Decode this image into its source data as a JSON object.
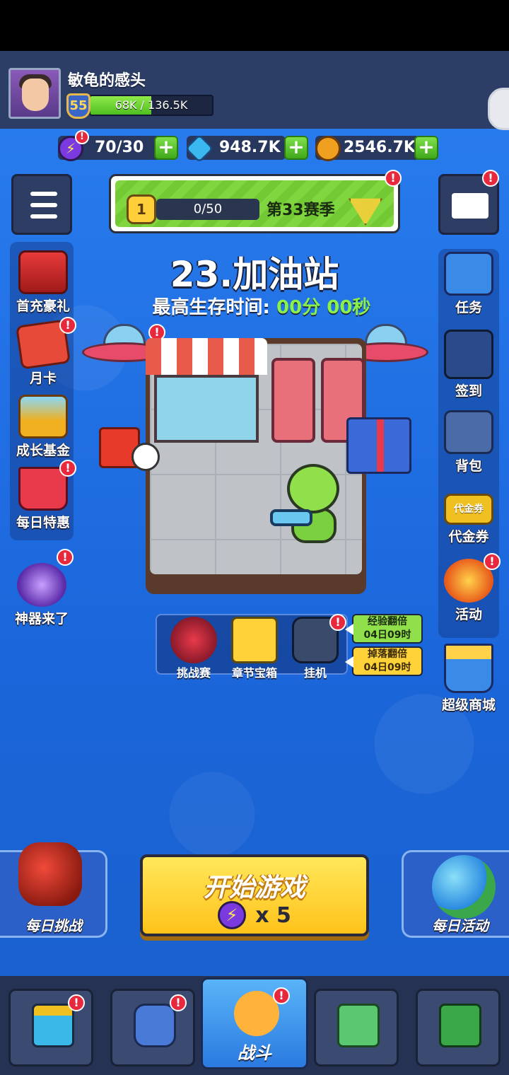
{
  "player": {
    "name": "敏龟的感头",
    "level": "55",
    "xp_text": "68K / 136.5K",
    "xp_fraction": 0.5
  },
  "resources": [
    {
      "icon": "energy-icon",
      "value": "70/30",
      "color": "#7a3ae0"
    },
    {
      "icon": "diamond-icon",
      "value": "948.7K",
      "color": "#3ab8f0"
    },
    {
      "icon": "coin-icon",
      "value": "2546.7K",
      "color": "#f0a020"
    }
  ],
  "season": {
    "level": "1",
    "progress": "0/50",
    "title": "第33赛季"
  },
  "stage": {
    "title": "23.加油站",
    "survive_label": "最高生存时间:",
    "survive_value": "00分 00秒"
  },
  "left_menu": [
    {
      "label": "首充豪礼",
      "icon": "treasure-chest-icon",
      "badge": false
    },
    {
      "label": "月卡",
      "icon": "month-card-icon",
      "badge": true
    },
    {
      "label": "成长基金",
      "icon": "growth-fund-icon",
      "badge": false
    },
    {
      "label": "每日特惠",
      "icon": "basket-icon",
      "badge": true
    },
    {
      "label": "神器来了",
      "icon": "artifact-icon",
      "badge": true
    }
  ],
  "right_menu": [
    {
      "label": "任务",
      "icon": "task-icon",
      "badge": false
    },
    {
      "label": "签到",
      "icon": "signin-icon",
      "badge": false
    },
    {
      "label": "背包",
      "icon": "backpack-icon",
      "badge": false
    },
    {
      "label": "代金券",
      "icon": "voucher-icon",
      "art_text": "代金券",
      "badge": false
    },
    {
      "label": "活动",
      "icon": "party-popper-icon",
      "badge": true
    },
    {
      "label": "超级商城",
      "icon": "shopping-cart-icon",
      "badge": false
    }
  ],
  "mini_actions": [
    {
      "label": "挑战赛",
      "icon": "crossed-swords-icon"
    },
    {
      "label": "章节宝箱",
      "icon": "chapter-chest-icon"
    },
    {
      "label": "挂机",
      "icon": "idle-robot-icon"
    }
  ],
  "boosts": [
    {
      "title": "经验翻倍",
      "time": "04日09时"
    },
    {
      "title": "掉落翻倍",
      "time": "04日09时"
    }
  ],
  "start_button": {
    "label": "开始游戏",
    "cost": "x 5"
  },
  "daily_challenge": {
    "label": "每日挑战"
  },
  "daily_activity": {
    "label": "每日活动"
  },
  "nav": [
    {
      "icon": "shop-icon",
      "label": "",
      "badge": true
    },
    {
      "icon": "armor-icon",
      "label": "",
      "badge": true
    },
    {
      "icon": "battle-icon",
      "label": "战斗",
      "badge": true,
      "active": true
    },
    {
      "icon": "map-icon",
      "label": "",
      "badge": false
    },
    {
      "icon": "upgrade-chip-icon",
      "label": "",
      "badge": false
    }
  ],
  "colors": {
    "background": "#1f6fe0",
    "accent_green": "#8af04a",
    "badge_red": "#e8283c",
    "button_yellow": "#ffd23a"
  }
}
